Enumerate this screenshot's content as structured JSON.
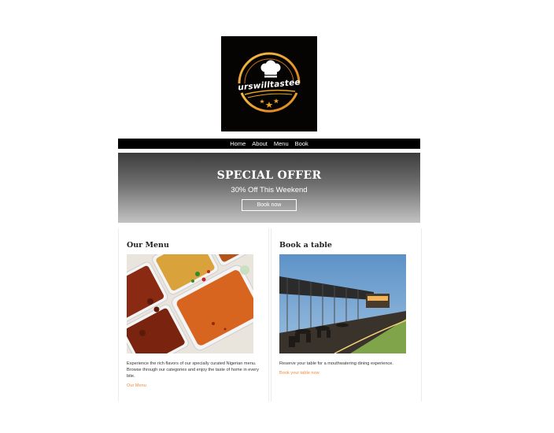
{
  "brand": {
    "logo_text": "urswilltastee"
  },
  "nav": {
    "items": [
      "Home",
      "About",
      "Menu",
      "Book"
    ]
  },
  "hero": {
    "title": "SPECIAL OFFER",
    "subtitle": "30% Off This Weekend",
    "button": "Book now"
  },
  "cards": {
    "menu": {
      "title": "Our Menu",
      "description": "Experience the rich flavors of our specially curated Nigerian menu. Browse through our categories and enjoy the taste of home in every bite.",
      "link": "Our Menu"
    },
    "book": {
      "title": "Book a table",
      "description": "Reserve your table for a mouthwatering dining experience.",
      "link": "Book your table now"
    }
  },
  "colors": {
    "accent": "#f08a3c",
    "logo_gold": "#e8a21c",
    "nav_bg": "#000000"
  }
}
